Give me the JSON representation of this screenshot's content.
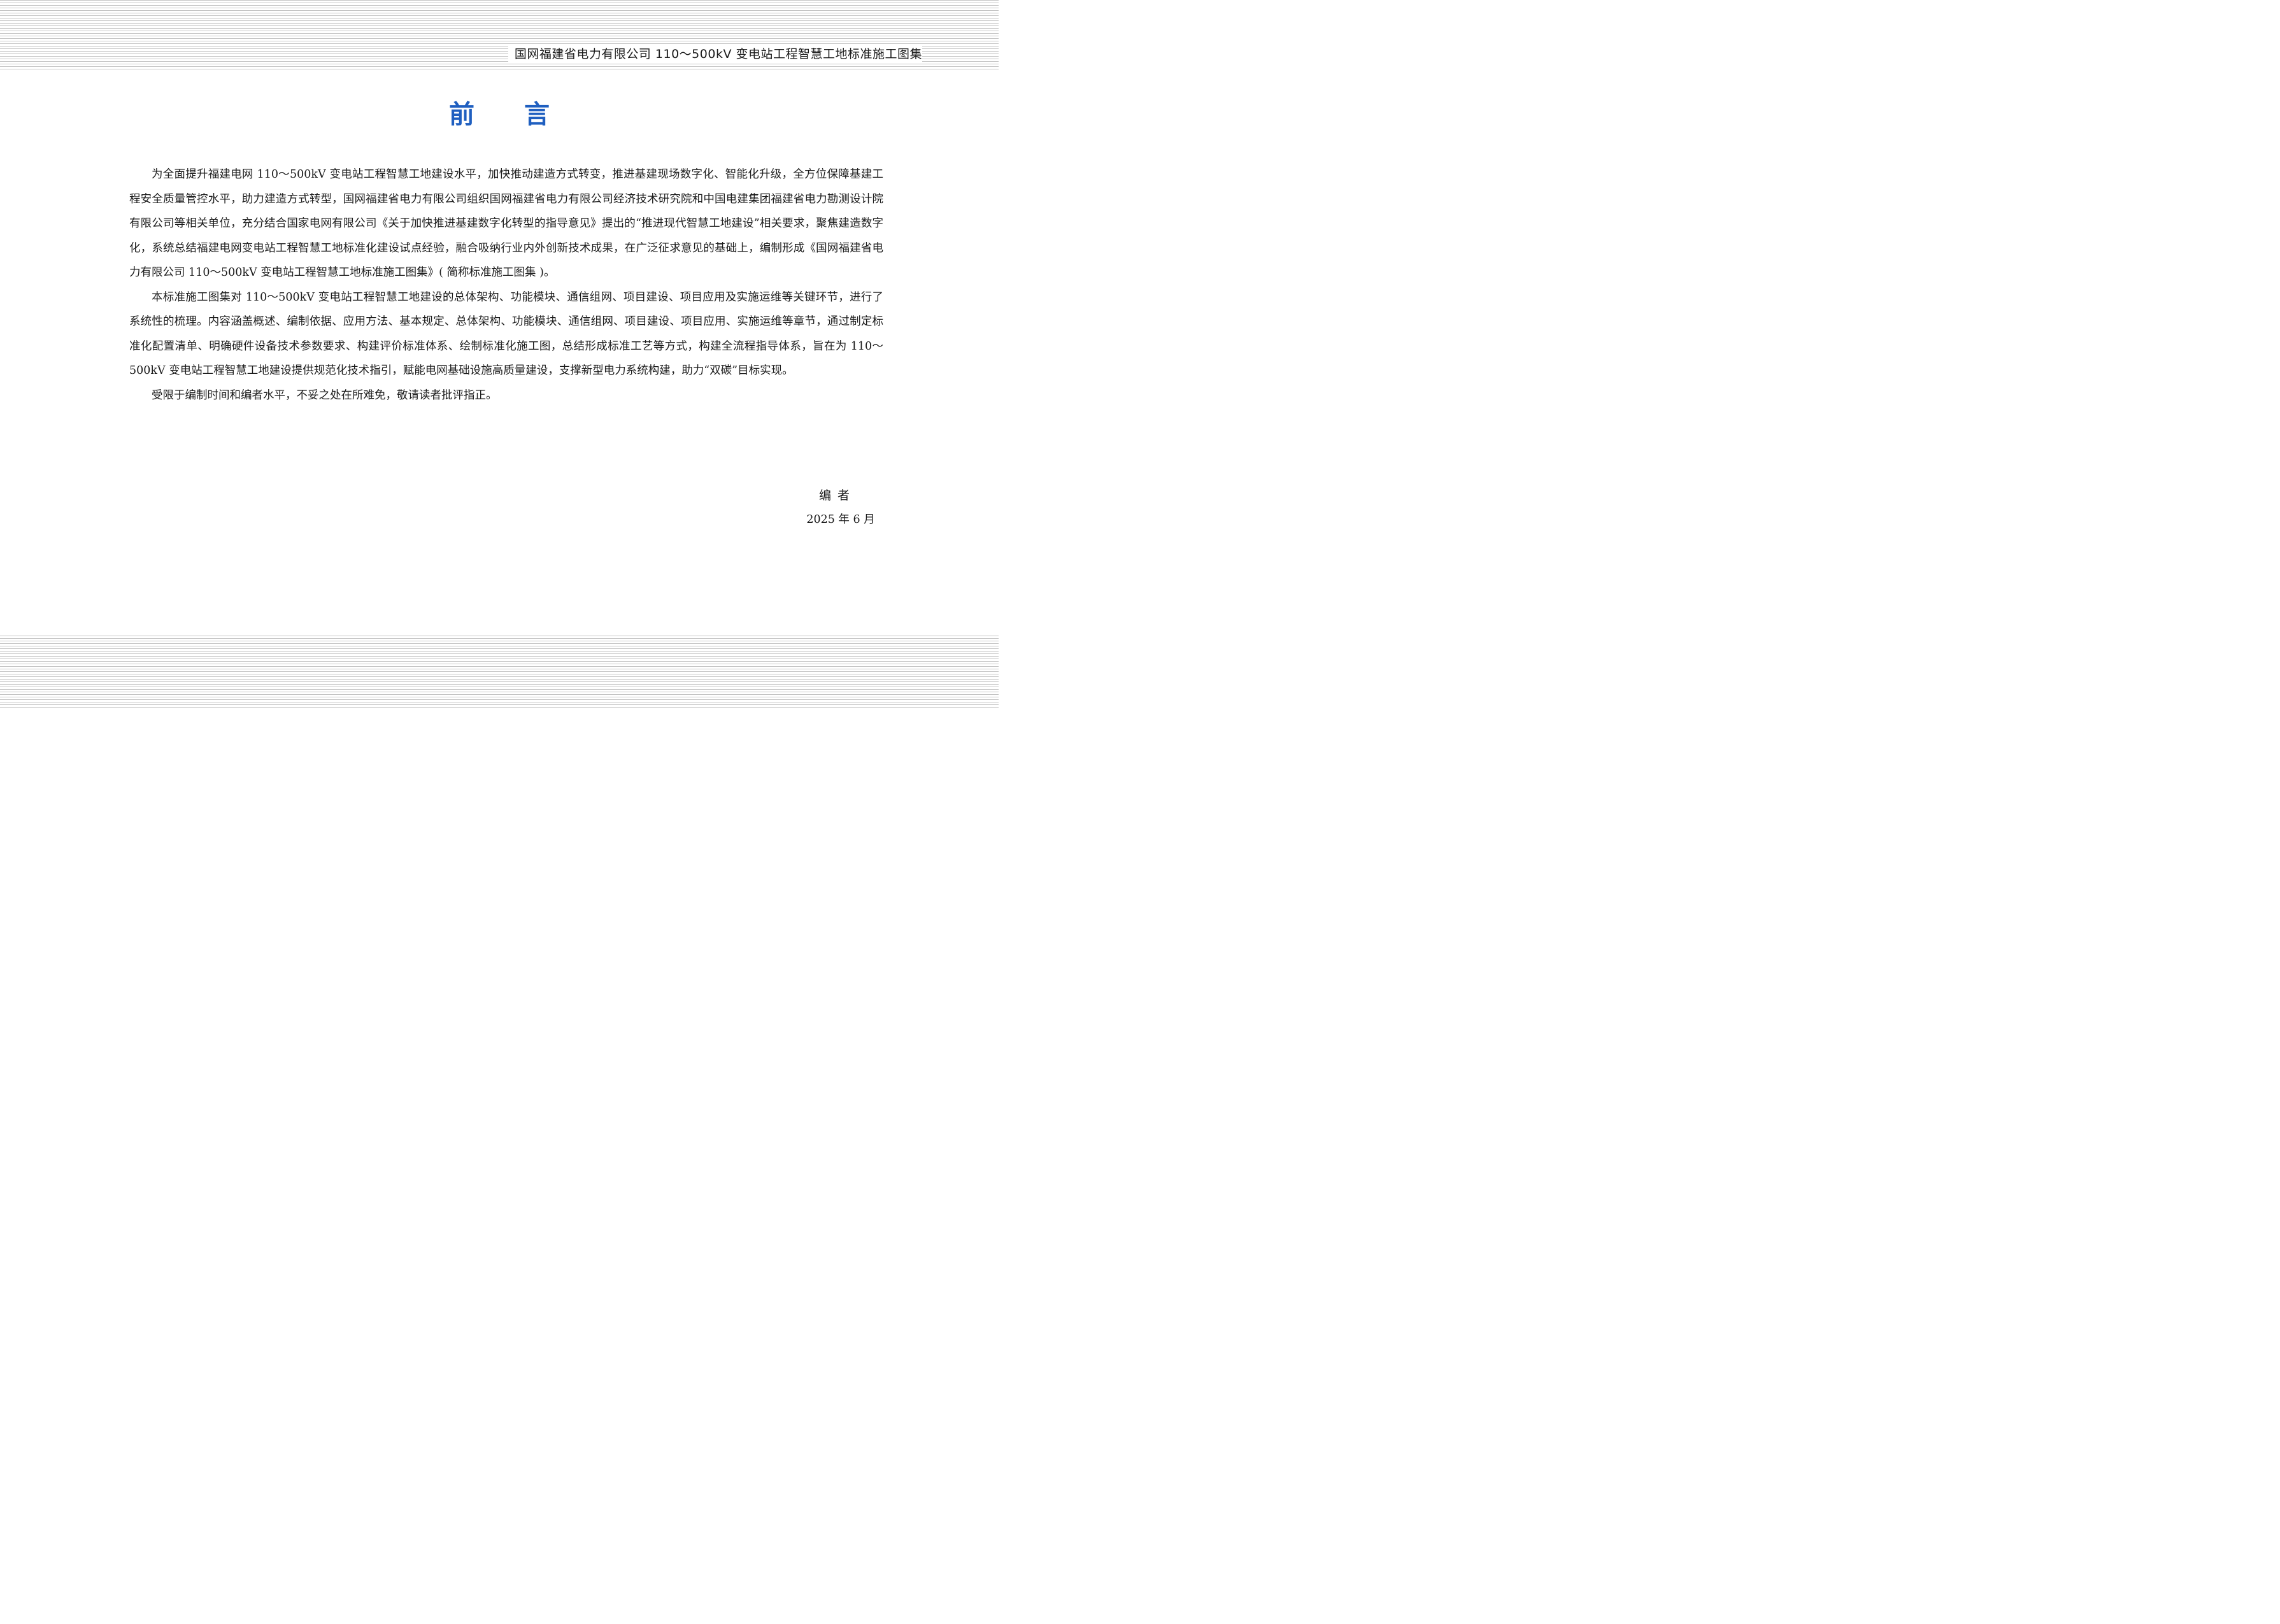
{
  "header": {
    "title": "国网福建省电力有限公司 110～500kV 变电站工程智慧工地标准施工图集"
  },
  "page_title": "前言",
  "paragraphs": [
    "为全面提升福建电网 110～500kV 变电站工程智慧工地建设水平，加快推动建造方式转变，推进基建现场数字化、智能化升级，全方位保障基建工程安全质量管控水平，助力建造方式转型，国网福建省电力有限公司组织国网福建省电力有限公司经济技术研究院和中国电建集团福建省电力勘测设计院有限公司等相关单位，充分结合国家电网有限公司《关于加快推进基建数字化转型的指导意见》提出的“推进现代智慧工地建设”相关要求，聚焦建造数字化，系统总结福建电网变电站工程智慧工地标准化建设试点经验，融合吸纳行业内外创新技术成果，在广泛征求意见的基础上，编制形成《国网福建省电力有限公司 110～500kV 变电站工程智慧工地标准施工图集》( 简称标准施工图集 )。",
    "本标准施工图集对 110～500kV 变电站工程智慧工地建设的总体架构、功能模块、通信组网、项目建设、项目应用及实施运维等关键环节，进行了系统性的梳理。内容涵盖概述、编制依据、应用方法、基本规定、总体架构、功能模块、通信组网、项目建设、项目应用、实施运维等章节，通过制定标准化配置清单、明确硬件设备技术参数要求、构建评价标准体系、绘制标准化施工图，总结形成标准工艺等方式，构建全流程指导体系，旨在为 110～500kV 变电站工程智慧工地建设提供规范化技术指引，赋能电网基础设施高质量建设，支撑新型电力系统构建，助力“双碳”目标实现。",
    "受限于编制时间和编者水平，不妥之处在所难免，敬请读者批评指正。"
  ],
  "signature": {
    "author": "编者",
    "date": "2025 年 6 月"
  },
  "colors": {
    "title": "#1f5fc0",
    "stripes": "#c4c4c4",
    "text": "#1a1a1a"
  }
}
